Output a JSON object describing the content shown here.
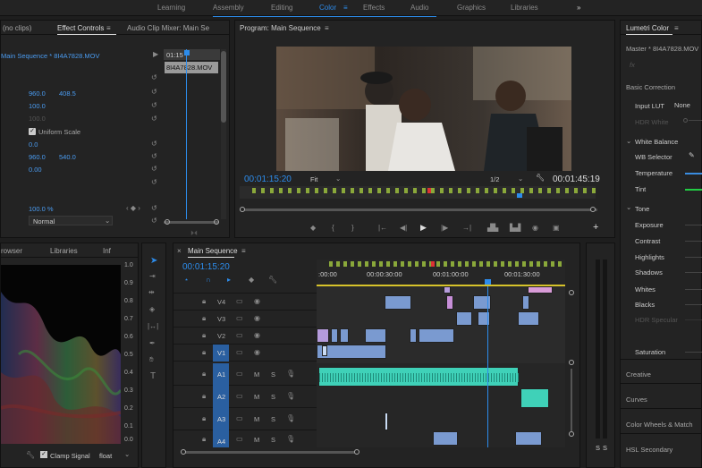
{
  "workspaces": [
    "Learning",
    "Assembly",
    "Editing",
    "Color",
    "Effects",
    "Audio",
    "Graphics",
    "Libraries"
  ],
  "active_workspace": "Color",
  "more_icon": "»",
  "source": {
    "no_clips": "(no clips)",
    "tab_effect_controls": "Effect Controls",
    "tab_audio_mixer": "Audio Clip Mixer: Main Se",
    "clip_label": "Main Sequence * 8I4A7828.MOV",
    "mini_clip": "8I4A7828.MOV",
    "mini_time": "01:15",
    "val_pos_x": "960.0",
    "val_pos_y": "408.5",
    "val_scale": "100.0",
    "val_scale_w": "100.0",
    "uniform_scale": "Uniform Scale",
    "val_rot": "0.0",
    "val_anchor_x": "960.0",
    "val_anchor_y": "540.0",
    "val_flicker": "0.00",
    "val_opacity": "100.0 %",
    "blend_mode": "Normal"
  },
  "program": {
    "title": "Program: Main Sequence",
    "timecode_in": "00:01:15:20",
    "fit": "Fit",
    "resolution": "1/2",
    "timecode_dur": "00:01:45:19"
  },
  "lumetri": {
    "title": "Lumetri Color",
    "master": "Master * 8I4A7828.MOV",
    "fx": "fx",
    "basic_correction": "Basic Correction",
    "input_lut": "Input LUT",
    "input_lut_val": "None",
    "hdr_white": "HDR White",
    "white_balance": "White Balance",
    "wb_selector": "WB Selector",
    "temperature": "Temperature",
    "tint": "Tint",
    "tone": "Tone",
    "exposure": "Exposure",
    "contrast": "Contrast",
    "highlights": "Highlights",
    "shadows": "Shadows",
    "whites": "Whites",
    "blacks": "Blacks",
    "hdr_specular": "HDR Specular",
    "saturation": "Saturation",
    "creative": "Creative",
    "curves": "Curves",
    "color_wheels": "Color Wheels & Match",
    "hsl_secondary": "HSL Secondary"
  },
  "scopes": {
    "tab_browser": "rowser",
    "tab_libraries": "Libraries",
    "tab_info": "Inf",
    "scale": [
      "1.0",
      "0.9",
      "0.8",
      "0.7",
      "0.6",
      "0.5",
      "0.4",
      "0.3",
      "0.2",
      "0.1",
      "0.0"
    ],
    "clamp_signal": "Clamp Signal",
    "float": "float"
  },
  "timeline": {
    "title": "Main Sequence",
    "timecode": "00:01:15:20",
    "ruler": [
      ":00:00",
      "00:00:30:00",
      "00:01:00:00",
      "00:01:30:00"
    ],
    "video_tracks": [
      "V4",
      "V3",
      "V2",
      "V1"
    ],
    "audio_tracks": [
      "A1",
      "A2",
      "A3",
      "A4"
    ],
    "meter_labels": [
      "S",
      "S"
    ]
  },
  "colors": {
    "accent": "#2d8ceb",
    "teal": "#3fd1b8",
    "green_slider": "#22cc44",
    "blue_slider": "#3a8ce0",
    "purple": "#b59bdb",
    "video_blue": "#7a9ad0"
  }
}
